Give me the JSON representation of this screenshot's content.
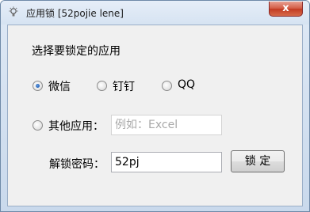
{
  "window": {
    "title": "应用锁 [52pojie lene]",
    "close_label": "x"
  },
  "form": {
    "prompt": "选择要锁定的应用",
    "options": [
      {
        "label": "微信",
        "checked": true
      },
      {
        "label": "钉钉",
        "checked": false
      },
      {
        "label": "QQ",
        "checked": false
      }
    ],
    "other": {
      "label": "其他应用：",
      "checked": false,
      "placeholder": "例如：Excel"
    },
    "password": {
      "label": "解锁密码：",
      "value": "52pj"
    },
    "lock_button": "锁 定"
  },
  "icons": {
    "app": "bulb-icon",
    "close": "close-icon"
  },
  "colors": {
    "close_red": "#c23a22",
    "radio_blue": "#1f5fb8"
  }
}
